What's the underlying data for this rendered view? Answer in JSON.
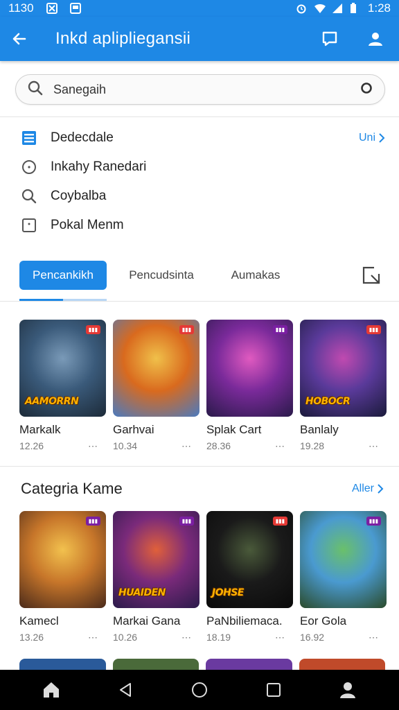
{
  "status_bar": {
    "time": "1130",
    "clock_right": "1:28"
  },
  "app_bar": {
    "title": "Inkd aplipliegansii"
  },
  "search": {
    "placeholder": "Sanegaih",
    "value": ""
  },
  "quick_links": [
    {
      "label": "Dedecdale",
      "icon": "list-icon",
      "more_label": "Uni"
    },
    {
      "label": "Inkahy Ranedari",
      "icon": "clock-icon"
    },
    {
      "label": "Coybalba",
      "icon": "search-icon"
    },
    {
      "label": "Pokal Menm",
      "icon": "square-dot-icon"
    }
  ],
  "tabs": [
    {
      "label": "Pencankikh",
      "active": true
    },
    {
      "label": "Pencudsinta",
      "active": false
    },
    {
      "label": "Aumakas",
      "active": false
    }
  ],
  "featured_games": [
    {
      "name": "Markalk",
      "rating": "12.26",
      "logo": "AAMORRN",
      "colors": [
        "#3a5a7a",
        "#7a9ab8",
        "#1c2a38"
      ]
    },
    {
      "name": "Garhvai",
      "rating": "10.34",
      "logo": "",
      "colors": [
        "#d96a1e",
        "#f0c04a",
        "#4a7abf"
      ]
    },
    {
      "name": "Splak Cart",
      "rating": "28.36",
      "logo": "",
      "colors": [
        "#7a2a9a",
        "#e05ac0",
        "#2a1a4a"
      ]
    },
    {
      "name": "Banlaly",
      "rating": "19.28",
      "logo": "HOBOCR",
      "colors": [
        "#5a3a9a",
        "#c04ab0",
        "#1a1a3a"
      ]
    }
  ],
  "category": {
    "title": "Categria Kame",
    "more_label": "Aller"
  },
  "category_games": [
    {
      "name": "Kamecl",
      "rating": "13.26",
      "logo": "",
      "colors": [
        "#c7762a",
        "#f2c14e",
        "#4a2a1a"
      ]
    },
    {
      "name": "Markai Gana",
      "rating": "10.26",
      "logo": "HUAIDEN",
      "colors": [
        "#7a2a7a",
        "#e0603a",
        "#2a1a4a"
      ]
    },
    {
      "name": "PaNbiliemaca.",
      "rating": "18.19",
      "logo": "JOHSE",
      "colors": [
        "#1a1a1a",
        "#4a5a3a",
        "#0a0a0a"
      ]
    },
    {
      "name": "Eor Gola",
      "rating": "16.92",
      "logo": "",
      "colors": [
        "#4a9ad0",
        "#6ac06a",
        "#2a4a2a"
      ]
    }
  ],
  "partial_row_colors": [
    "#2a5a9a",
    "#4a6a3a",
    "#6a3aa0",
    "#c04a2a"
  ],
  "colors": {
    "accent": "#1e88e5",
    "nav_bar": "#000000"
  }
}
